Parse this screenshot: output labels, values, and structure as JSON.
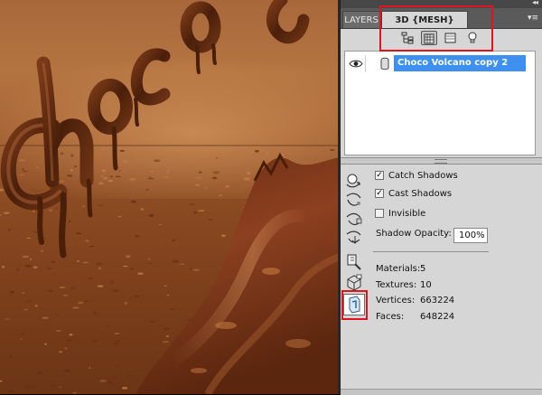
{
  "panel": {
    "collapse_glyph": "◂◂",
    "menu_glyph": "▾≡",
    "tabs": [
      {
        "label": "LAYERS",
        "active": false
      },
      {
        "label": "3D {MESH}",
        "active": true
      }
    ],
    "toolbar": [
      {
        "icon": "scene-icon"
      },
      {
        "icon": "mesh-icon",
        "active": true
      },
      {
        "icon": "materials-icon"
      },
      {
        "icon": "light-bulb-icon"
      }
    ],
    "layer": {
      "name": "Choco Volcano copy 2",
      "visible": true,
      "selected": true
    }
  },
  "mesh_settings": {
    "catch_shadows": {
      "label": "Catch Shadows",
      "checked": true
    },
    "cast_shadows": {
      "label": "Cast Shadows",
      "checked": true
    },
    "invisible": {
      "label": "Invisible",
      "checked": false
    },
    "shadow_opacity": {
      "label": "Shadow Opacity:",
      "value": "100%"
    }
  },
  "stats": {
    "materials": {
      "label": "Materials:",
      "value": "5"
    },
    "textures": {
      "label": "Textures:",
      "value": "10"
    },
    "vertices": {
      "label": "Vertices:",
      "value": "663224"
    },
    "faces": {
      "label": "Faces:",
      "value": "648224"
    }
  },
  "annotation_color": "#e0141e",
  "selection_color": "#3d8ff0"
}
